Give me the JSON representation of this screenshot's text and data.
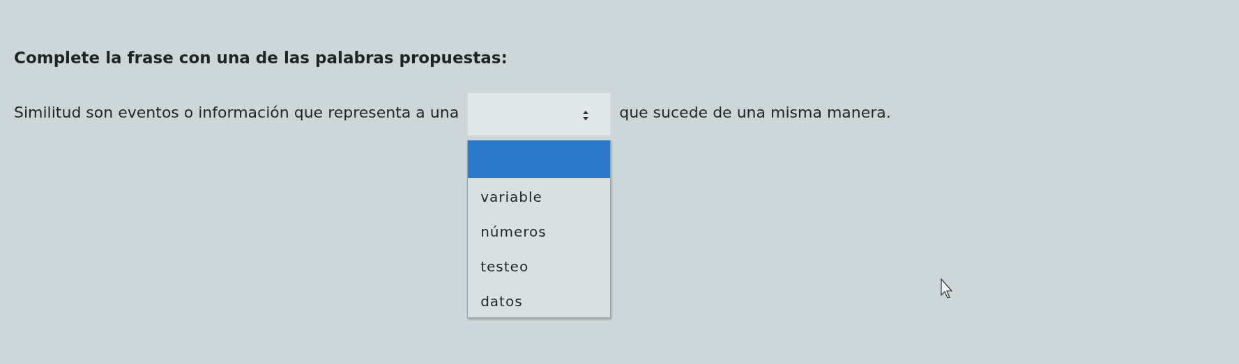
{
  "question": {
    "instruction": "Complete la frase con una de las palabras propuestas:",
    "text_before": "Similitud son eventos o información que representa a una",
    "dropdown": {
      "expanded": true,
      "options": [
        {
          "kind": "blank",
          "selected": true
        },
        {
          "kind": "word",
          "label": "variable",
          "selected": false
        },
        {
          "kind": "word",
          "label": "números",
          "selected": false
        },
        {
          "kind": "word",
          "label": "testeo",
          "selected": false
        },
        {
          "kind": "word",
          "label": "datos",
          "selected": false
        }
      ]
    },
    "text_after": "que sucede de una misma manera."
  }
}
